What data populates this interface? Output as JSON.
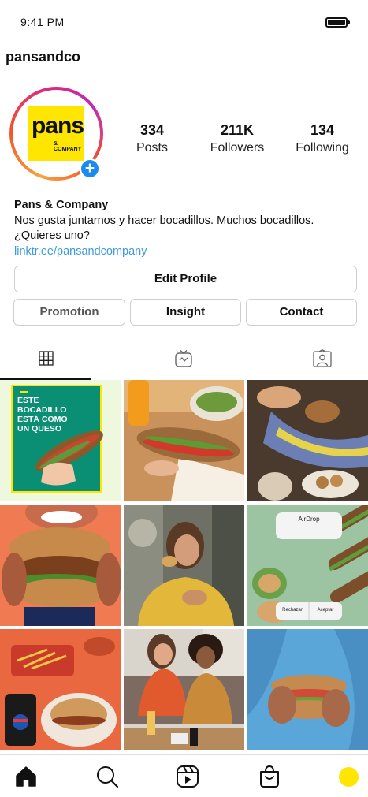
{
  "status_bar": {
    "time": "9:41 PM"
  },
  "header": {
    "username": "pansandco"
  },
  "profile": {
    "logo_text": "pans",
    "logo_subtext": "& COMPANY",
    "stats": [
      {
        "count": "334",
        "label": "Posts"
      },
      {
        "count": "211K",
        "label": "Followers"
      },
      {
        "count": "134",
        "label": "Following"
      }
    ],
    "display_name": "Pans & Company",
    "bio_line_1": "Nos gusta juntarnos y hacer bocadillos. Muchos bocadillos.",
    "bio_line_2": "¿Quieres uno?",
    "link": "linktr.ee/pansandcompany"
  },
  "buttons": {
    "edit_profile": "Edit Profile",
    "promotion": "Promotion",
    "insight": "Insight",
    "contact": "Contact"
  },
  "posts": {
    "post_1_caption": "ESTE BOCADILLO ESTÁ COMO UN QUESO",
    "post_6_title": "AirDrop",
    "post_6_decline": "Rechazar",
    "post_6_accept": "Aceptar"
  },
  "colors": {
    "brand_yellow": "#ffe600",
    "link_blue": "#3d9be0",
    "plus_blue": "#1a8cf0"
  },
  "icons": {
    "tabs": [
      "grid-icon",
      "igtv-icon",
      "tagged-icon"
    ],
    "bottom_nav": [
      "home-icon",
      "search-icon",
      "reels-icon",
      "shop-icon",
      "profile-avatar"
    ]
  }
}
